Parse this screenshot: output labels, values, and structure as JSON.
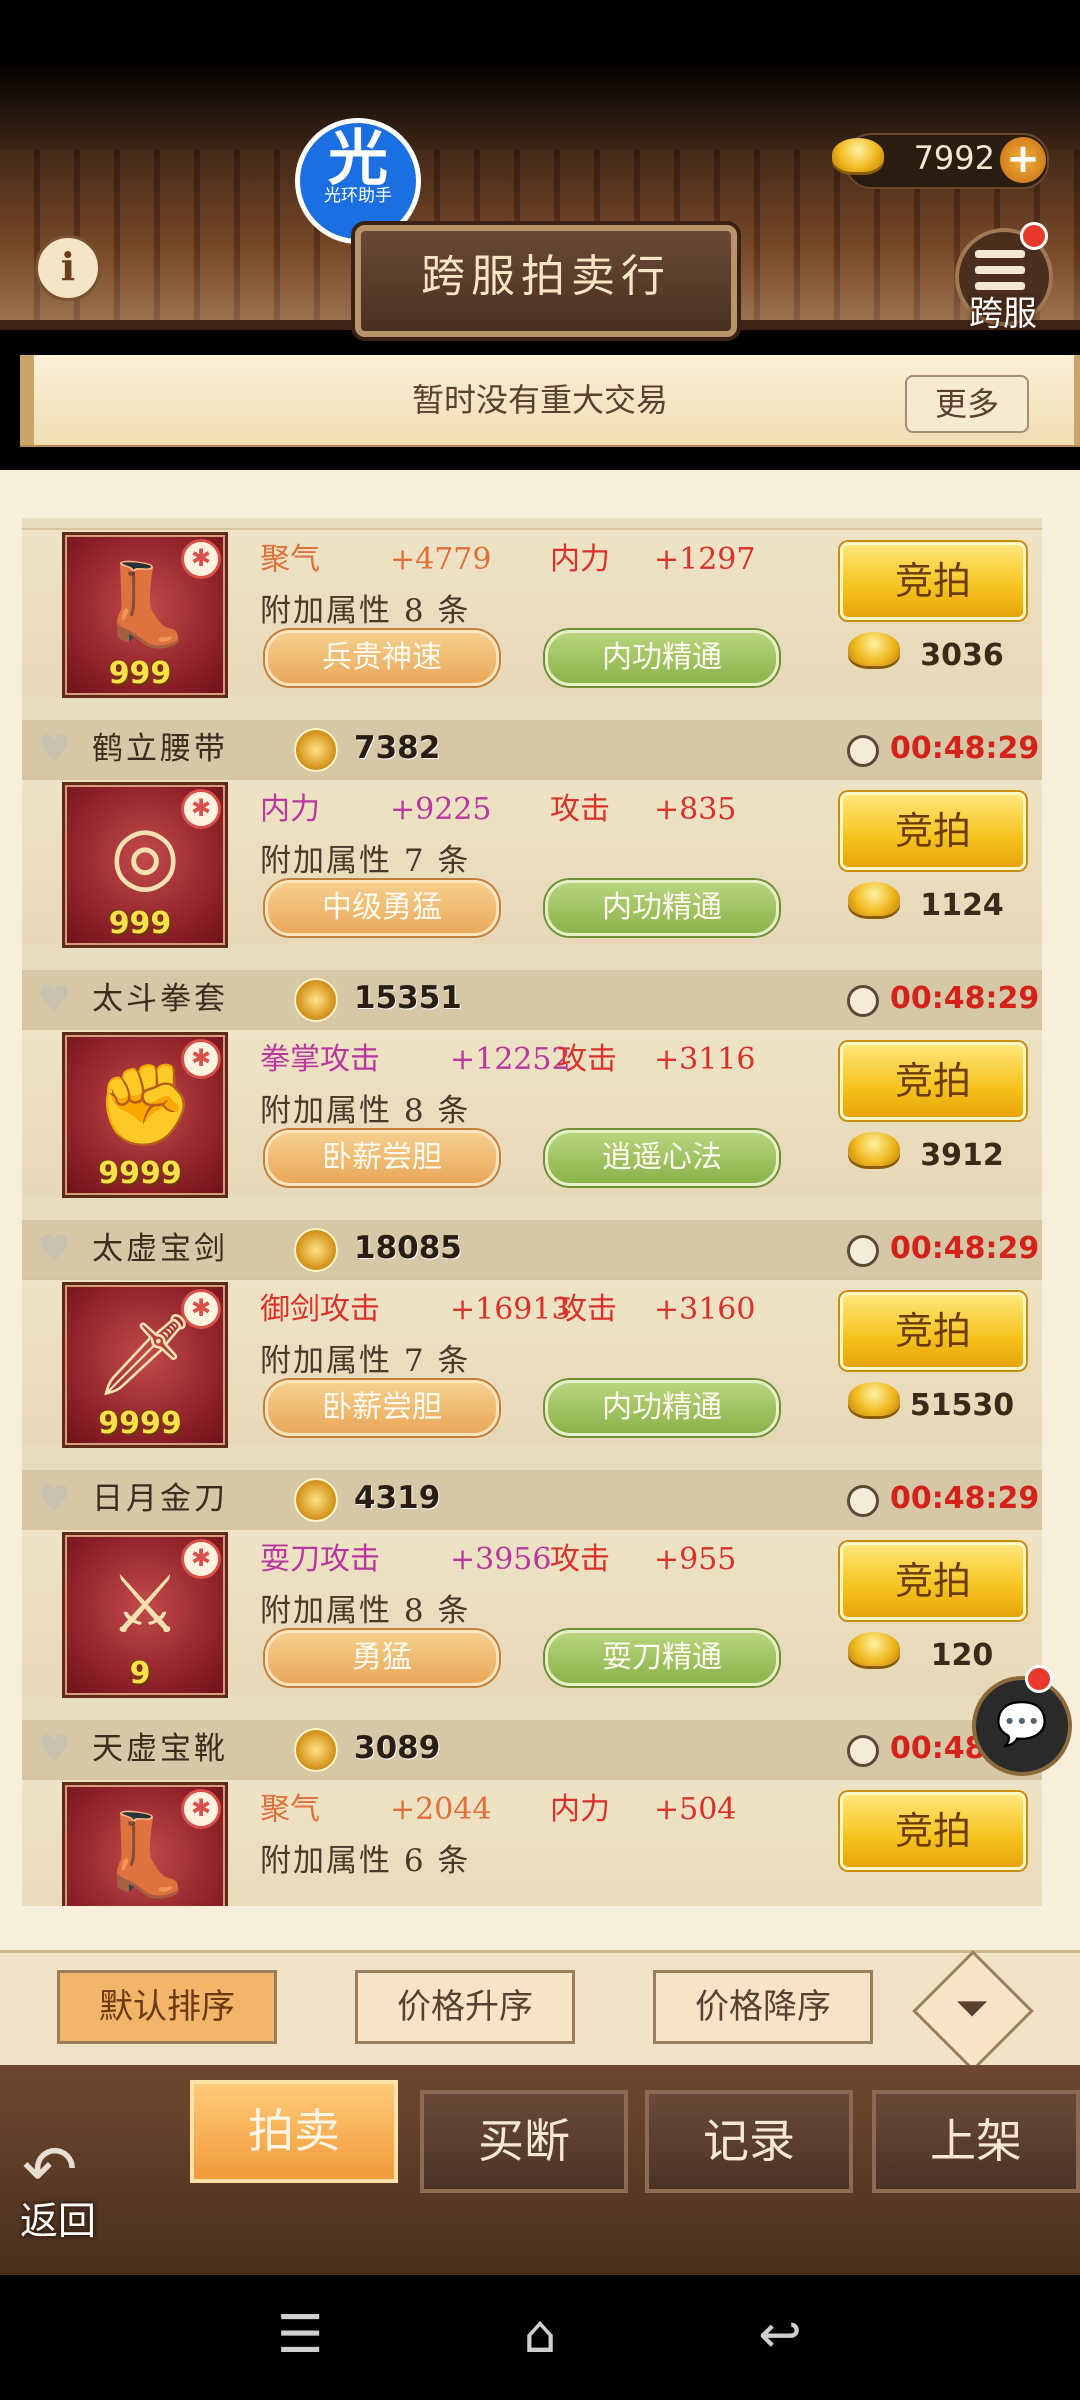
{
  "header": {
    "currency_amount": "7992",
    "helper_badge": {
      "glyph": "光",
      "label": "光环助手"
    },
    "title": "跨服拍卖行",
    "server_button_label": "跨服",
    "info_icon": "i",
    "add_currency_icon": "plus-icon"
  },
  "banner": {
    "text": "暂时没有重大交易",
    "more_label": "更多"
  },
  "items": [
    {
      "icon": "boots-icon",
      "glyph": "👢",
      "quantity": "999",
      "attr1_name": "聚气",
      "attr1_value": "+4779",
      "attr1_color": "#e0703a",
      "attr2_name": "内力",
      "attr2_value": "+1297",
      "attr2_color": "#d8322a",
      "bonus": "附加属性 8 条",
      "skill1": "兵贵神速",
      "skill2": "内功精通",
      "bid_label": "竞拍",
      "price": "3036"
    },
    {
      "name": "鹤立腰带",
      "reference_price": "7382",
      "timer": "00:48:29",
      "icon": "belt-icon",
      "glyph": "◎",
      "quantity": "999",
      "attr1_name": "内力",
      "attr1_value": "+9225",
      "attr1_color": "#b8389e",
      "attr2_name": "攻击",
      "attr2_value": "+835",
      "attr2_color": "#d8322a",
      "bonus": "附加属性 7 条",
      "skill1": "中级勇猛",
      "skill2": "内功精通",
      "bid_label": "竞拍",
      "price": "1124"
    },
    {
      "name": "太斗拳套",
      "reference_price": "15351",
      "timer": "00:48:29",
      "icon": "gauntlet-icon",
      "glyph": "✊",
      "quantity": "9999",
      "attr1_name": "拳掌攻击",
      "attr1_value": "+12252",
      "attr1_color": "#b8389e",
      "attr2_name": "攻击",
      "attr2_value": "+3116",
      "attr2_color": "#d8322a",
      "bonus": "附加属性 8 条",
      "skill1": "卧薪尝胆",
      "skill2": "逍遥心法",
      "bid_label": "竞拍",
      "price": "3912"
    },
    {
      "name": "太虚宝剑",
      "reference_price": "18085",
      "timer": "00:48:29",
      "icon": "sword-icon",
      "glyph": "🗡",
      "quantity": "9999",
      "attr1_name": "御剑攻击",
      "attr1_value": "+16913",
      "attr1_color": "#d8322a",
      "attr2_name": "攻击",
      "attr2_value": "+3160",
      "attr2_color": "#d8322a",
      "bonus": "附加属性 7 条",
      "skill1": "卧薪尝胆",
      "skill2": "内功精通",
      "bid_label": "竞拍",
      "price": "51530"
    },
    {
      "name": "日月金刀",
      "reference_price": "4319",
      "timer": "00:48:29",
      "icon": "blade-icon",
      "glyph": "⚔",
      "quantity": "9",
      "attr1_name": "耍刀攻击",
      "attr1_value": "+3956",
      "attr1_color": "#b8389e",
      "attr2_name": "攻击",
      "attr2_value": "+955",
      "attr2_color": "#d8322a",
      "bonus": "附加属性 8 条",
      "skill1": "勇猛",
      "skill2": "耍刀精通",
      "bid_label": "竞拍",
      "price": "120"
    },
    {
      "name": "天虚宝靴",
      "reference_price": "3089",
      "timer": "00:48:29",
      "icon": "boots-icon",
      "glyph": "👢",
      "quantity": "",
      "attr1_name": "聚气",
      "attr1_value": "+2044",
      "attr1_color": "#e0703a",
      "attr2_name": "内力",
      "attr2_value": "+504",
      "attr2_color": "#d8322a",
      "bonus": "附加属性 6 条",
      "skill1": "",
      "skill2": "",
      "bid_label": "竞拍",
      "price": ""
    }
  ],
  "sort": {
    "default": "默认排序",
    "price_asc": "价格升序",
    "price_desc": "价格降序",
    "filter_icon": "filter-icon"
  },
  "tabs": [
    "拍卖",
    "买断",
    "记录",
    "上架"
  ],
  "back_label": "返回",
  "colors": {
    "timer": "#d2221a",
    "active_tab": "#f19a3a",
    "bid_button": "#f5c21c"
  }
}
